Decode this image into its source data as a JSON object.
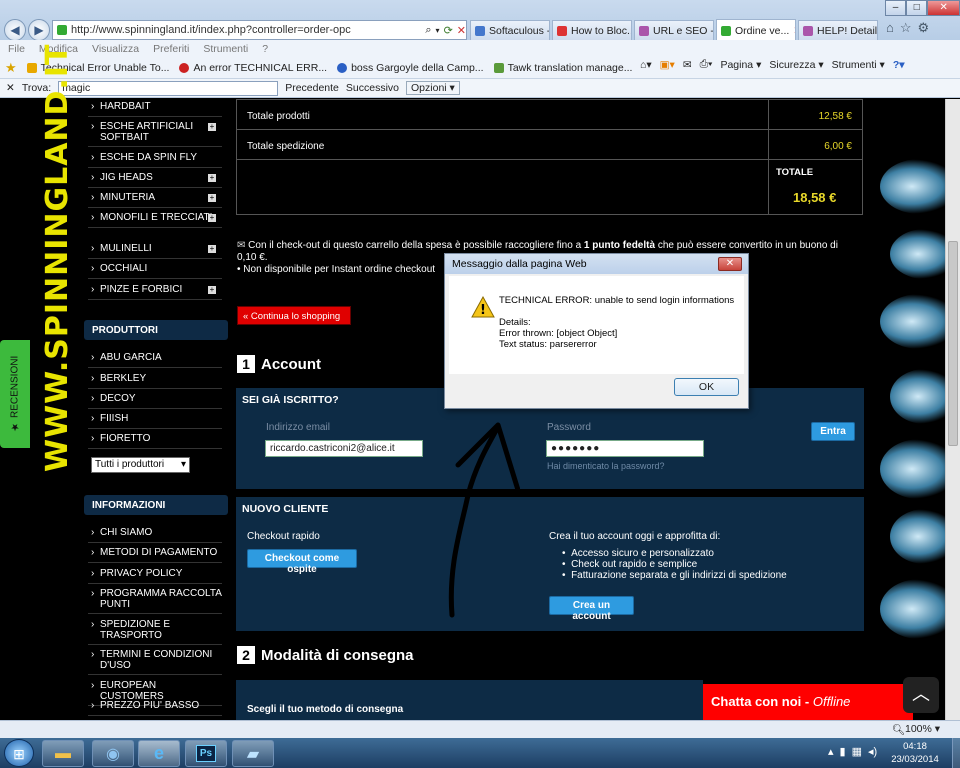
{
  "browser": {
    "url": "http://www.spinningland.it/index.php?controller=order-opc",
    "tabs": [
      "Softaculous - ...",
      "How to Bloc...",
      "URL e SEO - ...",
      "Ordine ve...",
      "HELP! Details..."
    ],
    "window_controls": [
      "–",
      "□",
      "✕"
    ],
    "menu": [
      "File",
      "Modifica",
      "Visualizza",
      "Preferiti",
      "Strumenti",
      "?"
    ],
    "favorites": [
      "Technical Error Unable To...",
      "An error TECHNICAL ERR...",
      "boss Gargoyle della Camp...",
      "Tawk translation manage..."
    ],
    "tools": [
      "Pagina",
      "Sicurezza",
      "Strumenti"
    ],
    "find_label": "Trova:",
    "find_value": "magic",
    "find_prev": "Precedente",
    "find_next": "Successivo",
    "find_options": "Opzioni",
    "zoom": "100%"
  },
  "site": {
    "logo_text": "WWW.SPINNINGLAND.IT",
    "recensioni": "RECENSIONI",
    "categories": [
      "HARDBAIT",
      "ESCHE ARTIFICIALI SOFTBAIT",
      "ESCHE DA SPIN FLY",
      "JIG HEADS",
      "MINUTERIA",
      "MONOFILI E TRECCIATI",
      "MULINELLI",
      "OCCHIALI",
      "PINZE E FORBICI"
    ],
    "produttori_title": "PRODUTTORI",
    "produttori": [
      "ABU GARCIA",
      "BERKLEY",
      "DECOY",
      "FIIISH",
      "FIORETTO"
    ],
    "produttori_select": "Tutti i produttori",
    "informazioni_title": "INFORMAZIONI",
    "informazioni": [
      "CHI SIAMO",
      "METODI DI PAGAMENTO",
      "PRIVACY POLICY",
      "PROGRAMMA RACCOLTA PUNTI",
      "SPEDIZIONE E TRASPORTO",
      "TERMINI E CONDIZIONI D'USO",
      "EUROPEAN CUSTOMERS",
      "PREZZO PIU' BASSO"
    ]
  },
  "cart": {
    "totale_prodotti_label": "Totale prodotti",
    "totale_prodotti": "12,58 €",
    "totale_spedizione_label": "Totale spedizione",
    "totale_spedizione": "6,00 €",
    "totale_label": "TOTALE",
    "totale": "18,58 €",
    "loyalty_text_1": "Con il check-out di questo carrello della spesa è possibile raccogliere fino a ",
    "loyalty_bold": "1 punto fedeltà",
    "loyalty_text_2": " che può essere convertito in un buono di",
    "loyalty_text_3": "0,10 €.",
    "loyalty_note": "• Non disponibile per Instant ordine checkout",
    "continue_button": "« Continua lo shopping"
  },
  "account": {
    "section_num": "1",
    "section_title": "Account",
    "registered_title": "SEI GIÀ ISCRITTO?",
    "email_label": "Indirizzo email",
    "email_value": "riccardo.castriconi2@alice.it",
    "password_label": "Password",
    "password_value": "●●●●●●●",
    "forgot": "Hai dimenticato la password?",
    "login_button": "Entra",
    "new_title": "NUOVO CLIENTE",
    "checkout_rapido": "Checkout rapido",
    "guest_button": "Checkout come ospite",
    "create_intro": "Crea il tuo account oggi e approfitta di:",
    "benefits": [
      "Accesso sicuro e personalizzato",
      "Check out rapido e semplice",
      "Fatturazione separata e gli indirizzi di spedizione"
    ],
    "create_button": "Crea un account"
  },
  "delivery": {
    "section_num": "2",
    "section_title": "Modalità di consegna",
    "choose": "Scegli il tuo metodo di consegna"
  },
  "dialog": {
    "title": "Messaggio dalla pagina Web",
    "heading": "TECHNICAL ERROR: unable to send login informations",
    "details_label": "Details:",
    "error_thrown": "Error thrown: [object Object]",
    "text_status": "Text status: parsererror",
    "ok": "OK",
    "close": "✕"
  },
  "chat": {
    "label": "Chatta con noi - ",
    "status": "Offline"
  },
  "taskbar": {
    "time": "04:18",
    "date": "23/03/2014"
  },
  "colors": {
    "accent_yellow": "#e8d82a",
    "panel_navy": "#0d2b45",
    "button_blue": "#2e9be0",
    "chat_red": "#ff0000"
  }
}
